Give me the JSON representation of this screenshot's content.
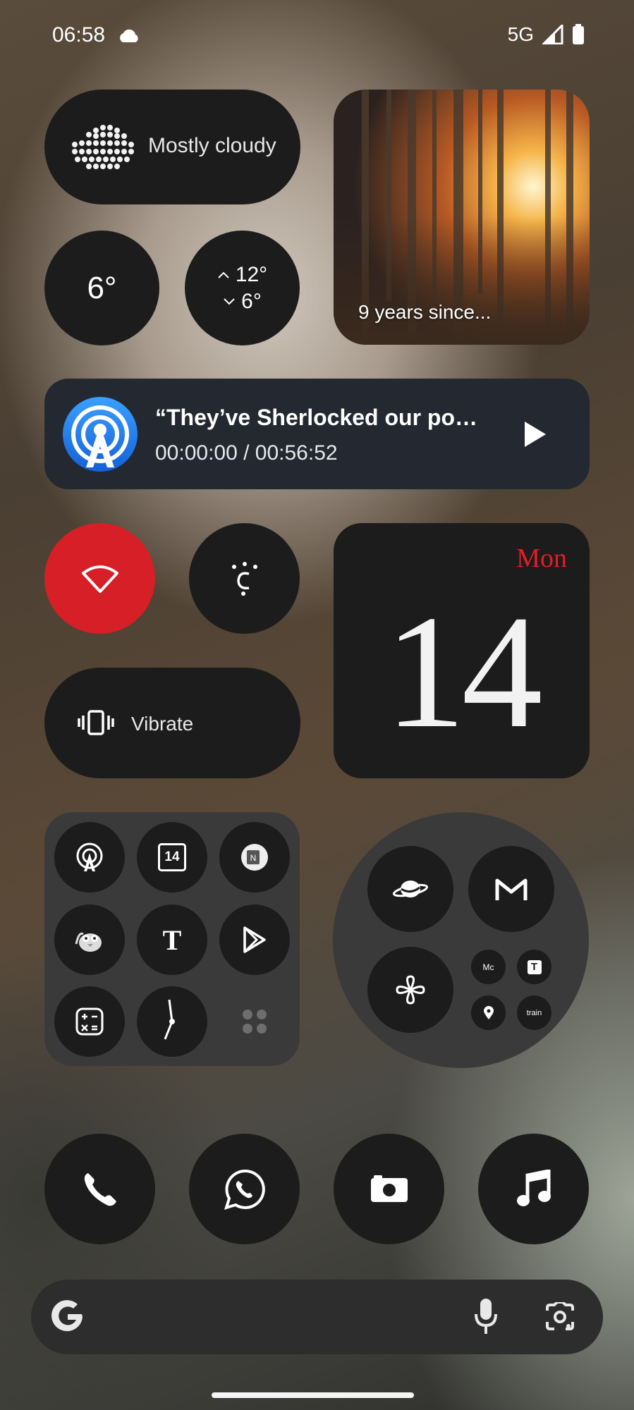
{
  "status_bar": {
    "time": "06:58",
    "network": "5G",
    "icons": [
      "cloud-icon",
      "signal-icon",
      "battery-icon"
    ]
  },
  "weather": {
    "condition": "Mostly cloudy",
    "current_temp": "6°",
    "high": "12°",
    "low": "6°"
  },
  "photo_widget": {
    "caption": "9 years since..."
  },
  "podcast_widget": {
    "title": "“They’ve Sherlocked our po…",
    "progress": "00:00:00 / 00:56:52",
    "icons": [
      "podcasts-icon",
      "play-icon"
    ]
  },
  "quick_toggles": {
    "wifi": {
      "icon": "wifi-icon",
      "active": true,
      "color": "#d61f26"
    },
    "caffeine": {
      "icon": "caffeine-icon"
    },
    "vibrate": {
      "label": "Vibrate",
      "icon": "vibrate-icon"
    }
  },
  "calendar_widget": {
    "day": "Mon",
    "date": "14",
    "day_color": "#e21d26"
  },
  "app_grid": {
    "icons": [
      "podcasts-icon",
      "calendar-icon",
      "notes-icon",
      "duolingo-icon",
      "nytimes-icon",
      "play-store-icon",
      "calculator-icon",
      "clock-icon",
      "more-apps-icon"
    ],
    "calendar_icon_label": "14"
  },
  "folder": {
    "icons": [
      "browser-icon",
      "gmail-icon",
      "pinwheel-icon"
    ],
    "mini_icons": [
      "Mc",
      "T",
      "location-icon",
      "train"
    ]
  },
  "dock": {
    "icons": [
      "phone-icon",
      "whatsapp-icon",
      "camera-icon",
      "music-icon"
    ]
  },
  "search_bar": {
    "icons": [
      "google-icon",
      "mic-icon",
      "lens-icon"
    ]
  }
}
